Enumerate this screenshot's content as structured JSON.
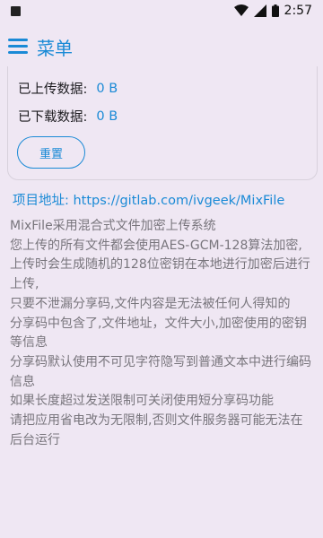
{
  "status": {
    "time": "2:57"
  },
  "appbar": {
    "title": "菜单"
  },
  "stats": {
    "upload_label": "已上传数据:",
    "upload_value": "0 B",
    "download_label": "已下载数据:",
    "download_value": "0 B",
    "reset_label": "重置"
  },
  "project": {
    "label": "项目地址: https://gitlab.com/ivgeek/MixFile"
  },
  "description": [
    "MixFile采用混合式文件加密上传系统",
    "您上传的所有文件都会使用AES-GCM-128算法加密,",
    "上传时会生成随机的128位密钥在本地进行加密后进行上传,",
    "只要不泄漏分享码,文件内容是无法被任何人得知的",
    "分享码中包含了,文件地址，文件大小,加密使用的密钥等信息",
    "分享码默认使用不可见字符隐写到普通文本中进行编码信息",
    "如果长度超过发送限制可关闭使用短分享码功能",
    "请把应用省电改为无限制,否则文件服务器可能无法在后台运行"
  ]
}
